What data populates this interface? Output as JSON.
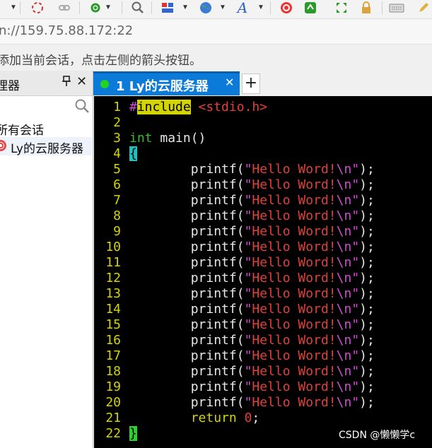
{
  "address": {
    "url_text": "n://159.75.88.172:22"
  },
  "hint": {
    "text": "添加当前会话，点击左侧的箭头按钮。"
  },
  "sidebar": {
    "title": "理器",
    "all_sessions": "所有会话",
    "session_item": "Ly的云服务器"
  },
  "tabs": {
    "active_label": "1 Ly的云服务器",
    "close_glyph": "✕",
    "new_glyph": "+"
  },
  "terminal": {
    "lines": [
      {
        "n": "1",
        "tokens": [
          [
            "#",
            "pre"
          ],
          [
            "include",
            "include"
          ],
          [
            " ",
            ""
          ],
          [
            "<stdio.h>",
            "header"
          ]
        ]
      },
      {
        "n": "2",
        "tokens": []
      },
      {
        "n": "3",
        "tokens": [
          [
            "int",
            "type"
          ],
          [
            " main()",
            ""
          ]
        ]
      },
      {
        "n": "4",
        "tokens": [
          [
            "{",
            "brace"
          ]
        ]
      },
      {
        "n": "5",
        "tokens": [
          [
            "        printf(",
            ""
          ],
          [
            "\"",
            "quote"
          ],
          [
            "Hello Word!",
            "str"
          ],
          [
            "\\n",
            "esc"
          ],
          [
            "\"",
            "quote"
          ],
          [
            ");",
            ""
          ]
        ]
      },
      {
        "n": "6",
        "tokens": [
          [
            "        printf(",
            ""
          ],
          [
            "\"",
            "quote"
          ],
          [
            "Hello Word!",
            "str"
          ],
          [
            "\\n",
            "esc"
          ],
          [
            "\"",
            "quote"
          ],
          [
            ");",
            ""
          ]
        ]
      },
      {
        "n": "7",
        "tokens": [
          [
            "        printf(",
            ""
          ],
          [
            "\"",
            "quote"
          ],
          [
            "Hello Word!",
            "str"
          ],
          [
            "\\n",
            "esc"
          ],
          [
            "\"",
            "quote"
          ],
          [
            ");",
            ""
          ]
        ]
      },
      {
        "n": "8",
        "tokens": [
          [
            "        printf(",
            ""
          ],
          [
            "\"",
            "quote"
          ],
          [
            "Hello Word!",
            "str"
          ],
          [
            "\\n",
            "esc"
          ],
          [
            "\"",
            "quote"
          ],
          [
            ");",
            ""
          ]
        ]
      },
      {
        "n": "9",
        "tokens": [
          [
            "        printf(",
            ""
          ],
          [
            "\"",
            "quote"
          ],
          [
            "Hello Word!",
            "str"
          ],
          [
            "\\n",
            "esc"
          ],
          [
            "\"",
            "quote"
          ],
          [
            ");",
            ""
          ]
        ]
      },
      {
        "n": "10",
        "tokens": [
          [
            "        printf(",
            ""
          ],
          [
            "\"",
            "quote"
          ],
          [
            "Hello Word!",
            "str"
          ],
          [
            "\\n",
            "esc"
          ],
          [
            "\"",
            "quote"
          ],
          [
            ");",
            ""
          ]
        ]
      },
      {
        "n": "11",
        "tokens": [
          [
            "        printf(",
            ""
          ],
          [
            "\"",
            "quote"
          ],
          [
            "Hello Word!",
            "str"
          ],
          [
            "\\n",
            "esc"
          ],
          [
            "\"",
            "quote"
          ],
          [
            ");",
            ""
          ]
        ]
      },
      {
        "n": "12",
        "tokens": [
          [
            "        printf(",
            ""
          ],
          [
            "\"",
            "quote"
          ],
          [
            "Hello Word!",
            "str"
          ],
          [
            "\\n",
            "esc"
          ],
          [
            "\"",
            "quote"
          ],
          [
            ");",
            ""
          ]
        ]
      },
      {
        "n": "13",
        "tokens": [
          [
            "        printf(",
            ""
          ],
          [
            "\"",
            "quote"
          ],
          [
            "Hello Word!",
            "str"
          ],
          [
            "\\n",
            "esc"
          ],
          [
            "\"",
            "quote"
          ],
          [
            ");",
            ""
          ]
        ]
      },
      {
        "n": "14",
        "tokens": [
          [
            "        printf(",
            ""
          ],
          [
            "\"",
            "quote"
          ],
          [
            "Hello Word!",
            "str"
          ],
          [
            "\\n",
            "esc"
          ],
          [
            "\"",
            "quote"
          ],
          [
            ");",
            ""
          ]
        ]
      },
      {
        "n": "15",
        "tokens": [
          [
            "        printf(",
            ""
          ],
          [
            "\"",
            "quote"
          ],
          [
            "Hello Word!",
            "str"
          ],
          [
            "\\n",
            "esc"
          ],
          [
            "\"",
            "quote"
          ],
          [
            ");",
            ""
          ]
        ]
      },
      {
        "n": "16",
        "tokens": [
          [
            "        printf(",
            ""
          ],
          [
            "\"",
            "quote"
          ],
          [
            "Hello Word!",
            "str"
          ],
          [
            "\\n",
            "esc"
          ],
          [
            "\"",
            "quote"
          ],
          [
            ");",
            ""
          ]
        ]
      },
      {
        "n": "17",
        "tokens": [
          [
            "        printf(",
            ""
          ],
          [
            "\"",
            "quote"
          ],
          [
            "Hello Word!",
            "str"
          ],
          [
            "\\n",
            "esc"
          ],
          [
            "\"",
            "quote"
          ],
          [
            ");",
            ""
          ]
        ]
      },
      {
        "n": "18",
        "tokens": [
          [
            "        printf(",
            ""
          ],
          [
            "\"",
            "quote"
          ],
          [
            "Hello Word!",
            "str"
          ],
          [
            "\\n",
            "esc"
          ],
          [
            "\"",
            "quote"
          ],
          [
            ");",
            ""
          ]
        ]
      },
      {
        "n": "19",
        "tokens": [
          [
            "        printf(",
            ""
          ],
          [
            "\"",
            "quote"
          ],
          [
            "Hello Word!",
            "str"
          ],
          [
            "\\n",
            "esc"
          ],
          [
            "\"",
            "quote"
          ],
          [
            ");",
            ""
          ]
        ]
      },
      {
        "n": "20",
        "tokens": [
          [
            "        printf(",
            ""
          ],
          [
            "\"",
            "quote"
          ],
          [
            "Hello Word!",
            "str"
          ],
          [
            "\\n",
            "esc"
          ],
          [
            "\"",
            "quote"
          ],
          [
            ");",
            ""
          ]
        ]
      },
      {
        "n": "21",
        "tokens": [
          [
            "        ",
            ""
          ],
          [
            "return",
            "kw"
          ],
          [
            " ",
            ""
          ],
          [
            "0",
            "num"
          ],
          [
            ";",
            ""
          ]
        ]
      },
      {
        "n": "22",
        "tokens": [
          [
            "}",
            "brace2"
          ]
        ]
      }
    ]
  },
  "watermark": {
    "text": "CSDN @懒懒学c"
  },
  "toolbar": {
    "icons": [
      "split-caret-icon",
      "quick-connect-icon",
      "link-icon",
      "settings-icon",
      "search-icon",
      "layout-icon",
      "globe-icon",
      "font-icon",
      "color-scheme-icon",
      "sftp-icon",
      "expand-icon",
      "lock-icon",
      "keyboard-icon",
      "pen-icon"
    ]
  },
  "colors": {
    "tab_active_bg": "#0b7ad8",
    "terminal_bg": "#000000",
    "line_number": "#d4d400",
    "string": "#e0403a",
    "preprocessor": "#d24bd2",
    "type_keyword": "#2fbf2f"
  }
}
